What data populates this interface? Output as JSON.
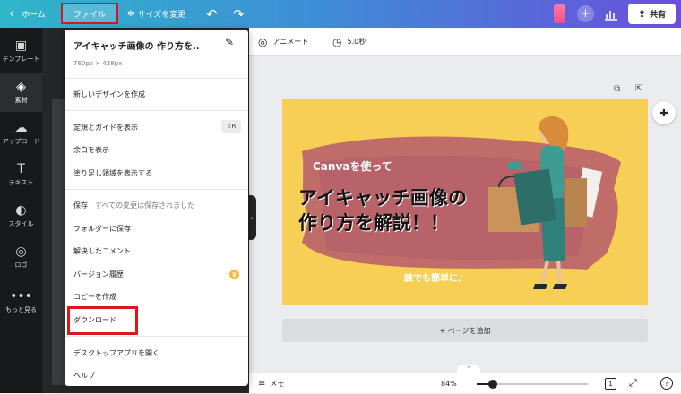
{
  "topbar": {
    "home_label": "ホーム",
    "file_label": "ファイル",
    "resize_label": "サイズを変更",
    "share_label": "共有"
  },
  "sidebar": {
    "items": [
      {
        "label": "テンプレート",
        "icon": "template-icon"
      },
      {
        "label": "素材",
        "icon": "elements-icon"
      },
      {
        "label": "アップロード",
        "icon": "upload-icon"
      },
      {
        "label": "テキスト",
        "icon": "text-icon"
      },
      {
        "label": "スタイル",
        "icon": "palette-icon"
      },
      {
        "label": "ロゴ",
        "icon": "logo-icon"
      },
      {
        "label": "もっと見る",
        "icon": "more-icon"
      }
    ]
  },
  "file_menu": {
    "title": "アイキャッチ画像の 作り方を..",
    "size": "760px × 428px",
    "new_design": "新しいデザインを作成",
    "show_rulers": "定規とガイドを表示",
    "show_rulers_shortcut": "⇧R",
    "show_margins": "余白を表示",
    "show_bleed": "塗り足し領域を表示する",
    "save": "保存",
    "save_status": "すべての変更は保存されました",
    "save_to_folder": "フォルダーに保存",
    "resolved_comments": "解決したコメント",
    "version_history": "バージョン履歴",
    "make_copy": "コピーを作成",
    "download": "ダウンロード",
    "open_desktop_app": "デスクトップアプリを開く",
    "help": "ヘルプ"
  },
  "editor_toolbar": {
    "animate_label": "アニメート",
    "duration_label": "5.0秒"
  },
  "design": {
    "small_title": "Canvaを使って",
    "headline_line1": "アイキャッチ画像の",
    "headline_line2": "作り方を解説！！",
    "tagline": "誰でも簡単に♪"
  },
  "canvas": {
    "add_page_label": "+ ページを追加"
  },
  "bottombar": {
    "notes_label": "メモ",
    "zoom_label": "84%",
    "page_number": "1",
    "help_symbol": "?"
  },
  "colors": {
    "topbar_gradient_start": "#2fb6c9",
    "topbar_gradient_end": "#6a4fdc",
    "design_background": "#f7cf55",
    "brush_stroke": "#b9606c",
    "highlight_box": "#e0131a"
  }
}
